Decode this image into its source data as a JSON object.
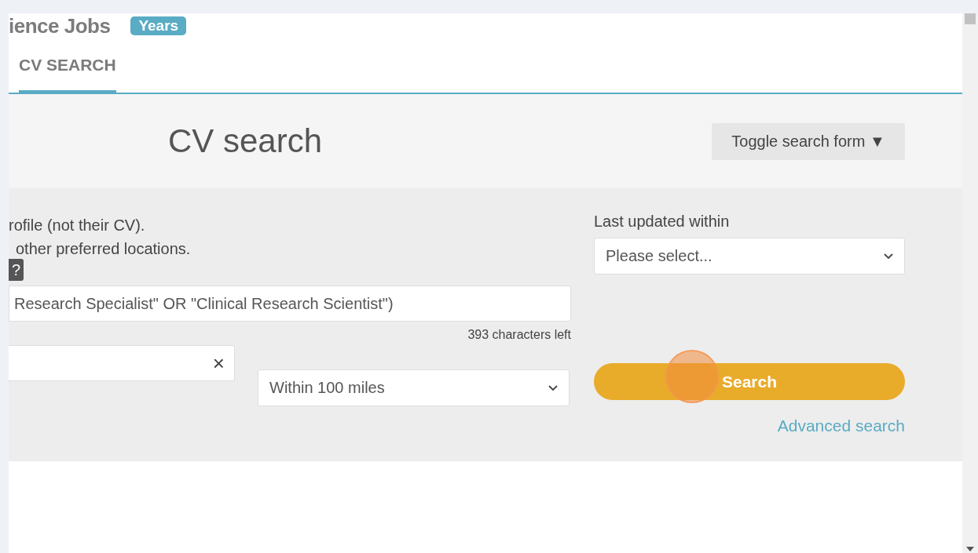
{
  "logo": {
    "text": "ience Jobs",
    "badge": "Years"
  },
  "tabs": [
    {
      "label": "CV SEARCH",
      "selected": true
    }
  ],
  "heading": "CV search",
  "toggle_button": {
    "label": "Toggle search form",
    "caret": "▼"
  },
  "help_lines": [
    "rofile (not their CV).",
    "other preferred locations."
  ],
  "help_badge": "?",
  "keywords": {
    "value": "Research Specialist\" OR \"Clinical Research Scientist\")",
    "counter": "393 characters left"
  },
  "location": {
    "clear": "×"
  },
  "distance": {
    "value": "Within 100 miles"
  },
  "last_updated": {
    "label": "Last updated within",
    "value": "Please select..."
  },
  "search_button": "Search",
  "advanced_link": "Advanced search"
}
